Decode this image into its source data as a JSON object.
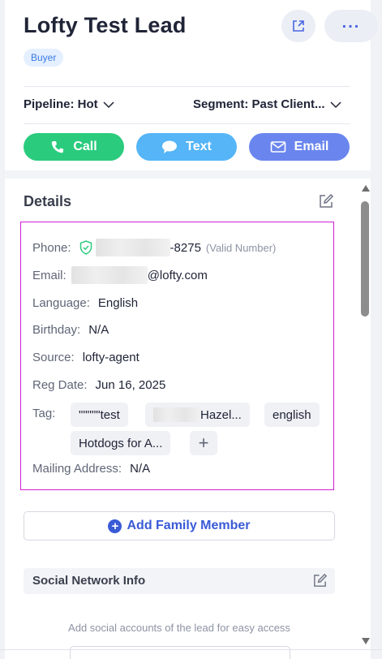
{
  "lead": {
    "name": "Lofty Test Lead",
    "type_badge": "Buyer"
  },
  "header_actions": {
    "share_icon": "share-icon",
    "more_icon": "more-horizontal-icon",
    "more_label": "..."
  },
  "meta": {
    "pipeline_label": "Pipeline: Hot",
    "segment_label": "Segment: Past Client..."
  },
  "actions": {
    "call": "Call",
    "text": "Text",
    "email": "Email",
    "colors": {
      "call": "#2bcb7e",
      "text": "#55b5f7",
      "email": "#6a86ee"
    }
  },
  "details": {
    "title": "Details",
    "phone_label": "Phone:",
    "phone_visible": "-8275",
    "phone_status": "(Valid Number)",
    "email_label": "Email:",
    "email_visible": "@lofty.com",
    "language_label": "Language:",
    "language_value": "English",
    "birthday_label": "Birthday:",
    "birthday_value": "N/A",
    "source_label": "Source:",
    "source_value": "lofty-agent",
    "reg_date_label": "Reg Date:",
    "reg_date_value": "Jun 16, 2025",
    "tag_label": "Tag:",
    "tags": [
      "\"\"\"\"\"test",
      "Hazel...",
      "english",
      "Hotdogs for A..."
    ],
    "add_tag": "+",
    "mailing_label": "Mailing Address:",
    "mailing_value": "N/A"
  },
  "family": {
    "add_label": "Add Family Member"
  },
  "social": {
    "title": "Social Network Info",
    "description": "Add social accounts of the lead for easy access"
  }
}
